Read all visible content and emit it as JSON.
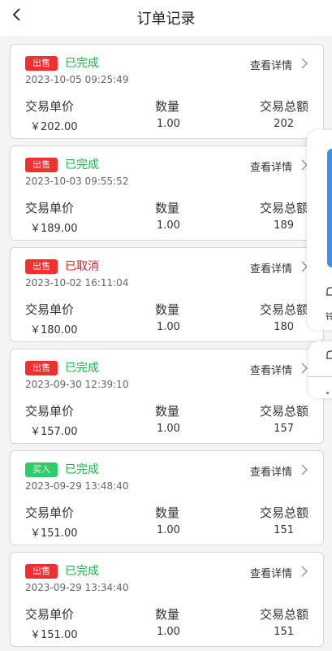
{
  "header": {
    "title": "订单记录"
  },
  "labels": {
    "unit_price": "交易单价",
    "quantity": "数量",
    "total": "交易总额",
    "detail": "查看详情"
  },
  "colors": {
    "sell": "#ee3030",
    "buy": "#2fcc6b",
    "completed": "#22b24c",
    "cancelled": "#e02424"
  },
  "orders": [
    {
      "badge": "出售",
      "type": "sell",
      "status": "已完成",
      "state": "completed",
      "datetime": "2023-10-05 09:25:49",
      "unit_price": "￥202.00",
      "quantity": "1.00",
      "total": "202"
    },
    {
      "badge": "出售",
      "type": "sell",
      "status": "已完成",
      "state": "completed",
      "datetime": "2023-10-03 09:55:52",
      "unit_price": "￥189.00",
      "quantity": "1.00",
      "total": "189"
    },
    {
      "badge": "出售",
      "type": "sell",
      "status": "已取消",
      "state": "cancelled",
      "datetime": "2023-10-02 16:11:04",
      "unit_price": "￥180.00",
      "quantity": "1.00",
      "total": "180"
    },
    {
      "badge": "出售",
      "type": "sell",
      "status": "已完成",
      "state": "completed",
      "datetime": "2023-09-30 12:39:10",
      "unit_price": "￥157.00",
      "quantity": "1.00",
      "total": "157"
    },
    {
      "badge": "买入",
      "type": "buy",
      "status": "已完成",
      "state": "completed",
      "datetime": "2023-09-29 13:48:40",
      "unit_price": "￥151.00",
      "quantity": "1.00",
      "total": "151"
    },
    {
      "badge": "出售",
      "type": "sell",
      "status": "已完成",
      "state": "completed",
      "datetime": "2023-09-29 13:34:40",
      "unit_price": "￥151.00",
      "quantity": "1.00",
      "total": "151"
    }
  ],
  "floating_widget": {
    "label": "铃"
  }
}
